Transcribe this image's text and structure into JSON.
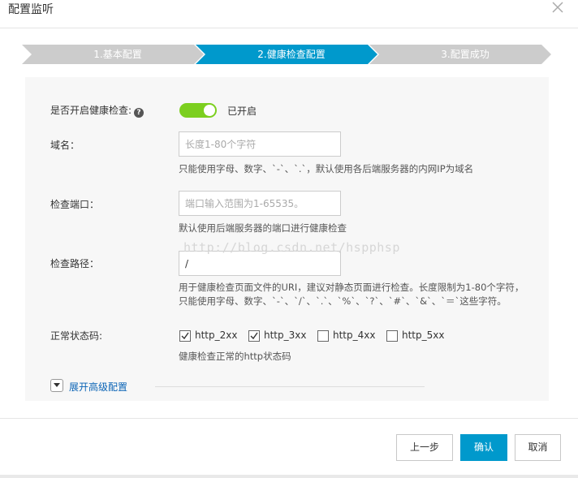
{
  "dialog": {
    "title": "配置监听",
    "close_icon": "close-icon"
  },
  "steps": [
    {
      "label": "1.基本配置",
      "state": "inactive"
    },
    {
      "label": "2.健康检查配置",
      "state": "active"
    },
    {
      "label": "3.配置成功",
      "state": "inactive"
    }
  ],
  "colors": {
    "step_active": "#0099cc",
    "step_inactive": "#cccccc",
    "toggle_on": "#7ccf1f",
    "primary_button": "#0099cc",
    "link": "#0b64b6"
  },
  "form": {
    "health_check": {
      "label": "是否开启健康检查:",
      "help_icon": "?",
      "enabled": true,
      "status_text": "已开启"
    },
    "domain": {
      "label": "域名：",
      "placeholder": "长度1-80个字符",
      "value": "",
      "hint": "只能使用字母、数字、`-`、`.`，默认使用各后端服务器的内网IP为域名"
    },
    "port": {
      "label": "检查端口：",
      "placeholder": "端口输入范围为1-65535。",
      "value": "",
      "hint": "默认使用后端服务器的端口进行健康检查"
    },
    "path": {
      "label": "检查路径：",
      "value": "/",
      "hint_line1": "用于健康检查页面文件的URI，建议对静态页面进行检查。长度限制为1-80个字符，",
      "hint_line2": "只能使用字母、数字、`-`、`/`、`.`、`%`、`?`、`#`、`&`、`＝`这些字符。"
    },
    "status_codes": {
      "label": "正常状态码:",
      "options": [
        {
          "label": "http_2xx",
          "checked": true
        },
        {
          "label": "http_3xx",
          "checked": true
        },
        {
          "label": "http_4xx",
          "checked": false
        },
        {
          "label": "http_5xx",
          "checked": false
        }
      ],
      "hint": "健康检查正常的http状态码"
    },
    "advanced": {
      "label": "展开高级配置",
      "icon": "chevron-down-icon"
    }
  },
  "watermark": "http://blog.csdn.net/hspphsp",
  "footer": {
    "prev_label": "上一步",
    "ok_label": "确认",
    "cancel_label": "取消"
  }
}
